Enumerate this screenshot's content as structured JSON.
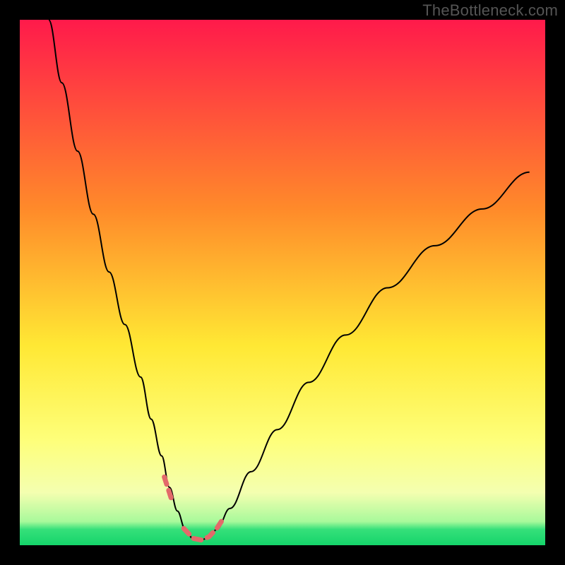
{
  "watermark": "TheBottleneck.com",
  "chart_data": {
    "type": "line",
    "title": "",
    "xlabel": "",
    "ylabel": "",
    "xlim": [
      0,
      100
    ],
    "ylim": [
      0,
      100
    ],
    "grid": false,
    "legend": false,
    "background_gradient_stops": [
      {
        "offset": 0,
        "color": "#ff1a4b"
      },
      {
        "offset": 36,
        "color": "#ff8a2a"
      },
      {
        "offset": 62,
        "color": "#ffe834"
      },
      {
        "offset": 80,
        "color": "#feff7a"
      },
      {
        "offset": 90,
        "color": "#f4ffb0"
      },
      {
        "offset": 95.5,
        "color": "#a8f99b"
      },
      {
        "offset": 97,
        "color": "#35e07a"
      },
      {
        "offset": 100,
        "color": "#15d46a"
      }
    ],
    "series": [
      {
        "name": "bottleneck-curve",
        "color": "#000000",
        "x": [
          5.5,
          8,
          11,
          14,
          17,
          20,
          23,
          25,
          27,
          28.5,
          30,
          31.5,
          33,
          34.5,
          36,
          37.5,
          40,
          44,
          49,
          55,
          62,
          70,
          79,
          88,
          97
        ],
        "y": [
          100,
          88,
          75,
          63,
          52,
          42,
          32,
          24,
          17,
          11,
          6.5,
          3,
          1.2,
          1.0,
          1.5,
          3,
          7,
          14,
          22,
          31,
          40,
          49,
          57,
          64,
          71
        ]
      }
    ],
    "marker_band": {
      "name": "optimal-range-markers",
      "color": "#e36a6a",
      "stroke_width": 7,
      "segments": [
        {
          "x": [
            27.5,
            28.8
          ],
          "y": [
            13,
            9
          ]
        },
        {
          "x": [
            31.2,
            33.0,
            34.5,
            36.0,
            37.5,
            38.8
          ],
          "y": [
            3.2,
            1.3,
            1.0,
            1.6,
            3.2,
            5.2
          ]
        }
      ]
    }
  }
}
